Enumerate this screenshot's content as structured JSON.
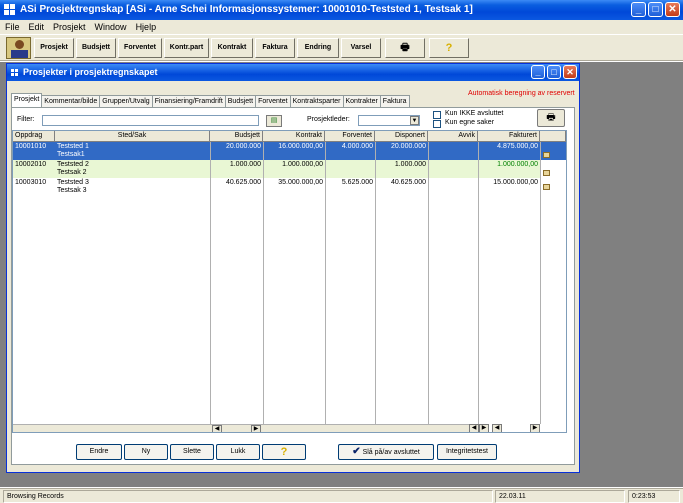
{
  "window": {
    "title": "ASi Prosjektregnskap [ASi - Arne Schei Informasjonssystemer: 10001010-Teststed 1, Testsak 1]"
  },
  "menu": [
    "File",
    "Edit",
    "Prosjekt",
    "Window",
    "Hjelp"
  ],
  "toolbar": {
    "buttons": [
      "Prosjekt",
      "Budsjett",
      "Forventet",
      "Kontr.part",
      "Kontrakt",
      "Faktura",
      "Endring",
      "Varsel"
    ],
    "print_icon": "🖶",
    "help_icon": "?"
  },
  "child": {
    "title": "Prosjekter i prosjektregnskapet",
    "tabs": [
      "Prosjekt",
      "Kommentar/bilde",
      "Grupper/Utvalg",
      "Finansiering/Framdrift",
      "Budsjett",
      "Forventet",
      "Kontraktsparter",
      "Kontrakter",
      "Faktura"
    ],
    "auto_calc": "Automatisk beregning av reservert",
    "filter_label": "Filter:",
    "filter_value": "",
    "projectleader_label": "Prosjektleder:",
    "projectleader_value": "",
    "chk_not_closed": "Kun IKKE avsluttet",
    "chk_own": "Kun egne saker"
  },
  "grid": {
    "columns": [
      "Oppdrag",
      "Sted/Sak",
      "Budsjett",
      "Kontrakt",
      "Forventet",
      "Disponert",
      "Avvik",
      "Fakturert"
    ],
    "rows": [
      {
        "oppdrag": "10001010",
        "sted": "Teststed 1",
        "sak": "Testsak1",
        "budsjett": "20.000.000",
        "kontrakt": "16.000.000,00",
        "forventet": "4.000.000",
        "disponert": "20.000.000",
        "avvik": "",
        "fakturert": "4.875.000,00"
      },
      {
        "oppdrag": "10002010",
        "sted": "Teststed 2",
        "sak": "Testsak 2",
        "budsjett": "1.000.000",
        "kontrakt": "1.000.000,00",
        "forventet": "",
        "disponert": "1.000.000",
        "avvik": "",
        "fakturert": "1.000.000,00"
      },
      {
        "oppdrag": "10003010",
        "sted": "Teststed 3",
        "sak": "Testsak 3",
        "budsjett": "40.625.000",
        "kontrakt": "35.000.000,00",
        "forventet": "5.625.000",
        "disponert": "40.625.000",
        "avvik": "",
        "fakturert": "15.000.000,00"
      }
    ]
  },
  "buttons": {
    "endre": "Endre",
    "ny": "Ny",
    "slette": "Slette",
    "lukk": "Lukk",
    "help": "?",
    "toggle_closed": "Slå på/av avsluttet",
    "integrity": "Integritetstest"
  },
  "status": {
    "message": "Browsing Records",
    "date": "22.03.11",
    "time": "0:23:53"
  },
  "colors": {
    "title_blue": "#0048d8",
    "selected_row": "#316ac5",
    "green_row": "#e9f7d4",
    "warning_red": "#e00000"
  }
}
